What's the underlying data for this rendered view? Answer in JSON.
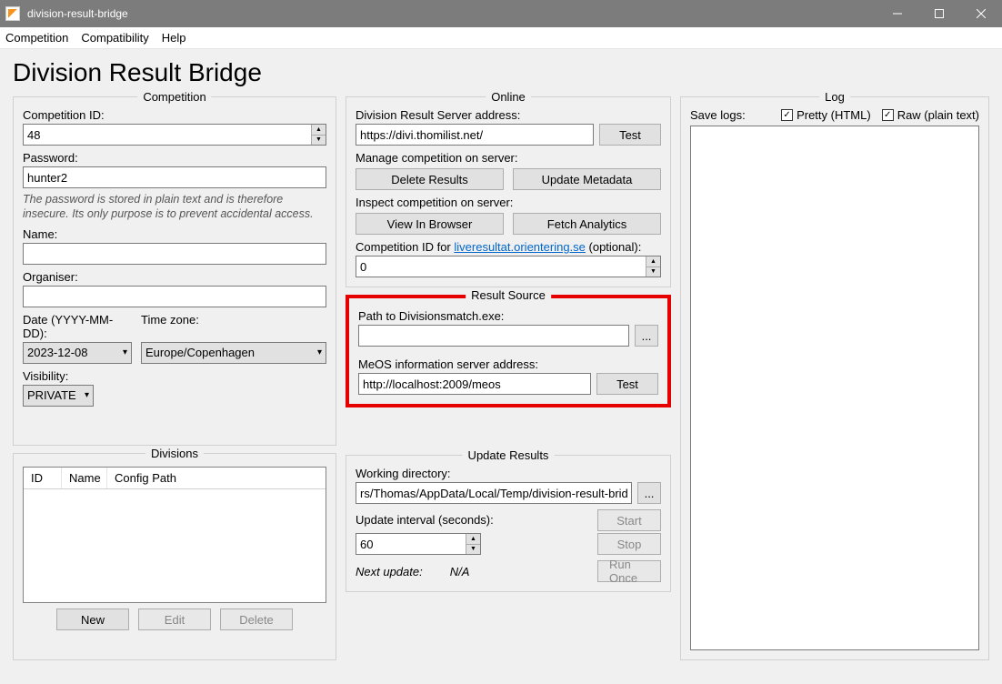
{
  "window": {
    "title": "division-result-bridge"
  },
  "menu": {
    "competition": "Competition",
    "compatibility": "Compatibility",
    "help": "Help"
  },
  "page_title": "Division Result Bridge",
  "competition": {
    "group_title": "Competition",
    "id_label": "Competition ID:",
    "id_value": "48",
    "password_label": "Password:",
    "password_value": "hunter2",
    "password_hint": "The password is stored in plain text and is therefore insecure. Its only purpose is to prevent accidental access.",
    "name_label": "Name:",
    "name_value": "",
    "organiser_label": "Organiser:",
    "organiser_value": "",
    "date_label": "Date (YYYY-MM-DD):",
    "date_value": "2023-12-08",
    "timezone_label": "Time zone:",
    "timezone_value": "Europe/Copenhagen",
    "visibility_label": "Visibility:",
    "visibility_value": "PRIVATE"
  },
  "divisions": {
    "group_title": "Divisions",
    "col_id": "ID",
    "col_name": "Name",
    "col_config": "Config Path",
    "btn_new": "New",
    "btn_edit": "Edit",
    "btn_delete": "Delete"
  },
  "online": {
    "group_title": "Online",
    "server_label": "Division Result Server address:",
    "server_value": "https://divi.thomilist.net/",
    "btn_test": "Test",
    "manage_label": "Manage competition on server:",
    "btn_delete_results": "Delete Results",
    "btn_update_metadata": "Update Metadata",
    "inspect_label": "Inspect competition on server:",
    "btn_view_browser": "View In Browser",
    "btn_fetch_analytics": "Fetch Analytics",
    "live_prefix": "Competition ID for ",
    "live_link": "liveresultat.orientering.se",
    "live_suffix": " (optional):",
    "live_value": "0"
  },
  "result_source": {
    "group_title": "Result Source",
    "path_label": "Path to Divisionsmatch.exe:",
    "path_value": "",
    "browse": "...",
    "meos_label": "MeOS information server address:",
    "meos_value": "http://localhost:2009/meos",
    "btn_test": "Test"
  },
  "update_results": {
    "group_title": "Update Results",
    "workdir_label": "Working directory:",
    "workdir_value": "rs/Thomas/AppData/Local/Temp/division-result-bridge",
    "browse": "...",
    "interval_label": "Update interval (seconds):",
    "interval_value": "60",
    "btn_start": "Start",
    "btn_stop": "Stop",
    "next_label": "Next update:",
    "next_value": "N/A",
    "btn_runonce": "Run Once"
  },
  "log": {
    "group_title": "Log",
    "save_label": "Save logs:",
    "cb_pretty": "Pretty (HTML)",
    "cb_raw": "Raw (plain text)"
  }
}
